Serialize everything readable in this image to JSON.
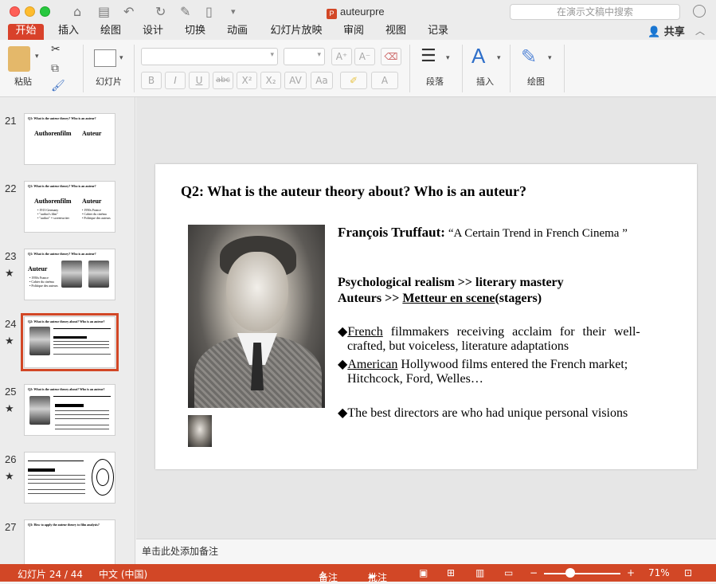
{
  "window": {
    "title": "auteurpre",
    "search_placeholder": "在演示文稿中搜索"
  },
  "tabs": [
    "开始",
    "插入",
    "绘图",
    "设计",
    "切换",
    "动画",
    "幻灯片放映",
    "审阅",
    "视图",
    "记录"
  ],
  "active_tab": "开始",
  "share_label": "共享",
  "ribbon": {
    "paste": "粘贴",
    "slide": "幻灯片",
    "paragraph": "段落",
    "insert": "插入",
    "draw": "绘图",
    "fmt": {
      "bold": "B",
      "italic": "I",
      "underline": "U",
      "strike": "abc",
      "superscript": "X²",
      "subscript": "X₂",
      "spacing": "AV",
      "case": "Aa",
      "font_color": "A"
    }
  },
  "thumbnails": [
    {
      "num": "21",
      "star": false,
      "title": "Q1: What is the auteur theory? Who is an auteur?",
      "col1": "Authorenfilm",
      "col2": "Auteur"
    },
    {
      "num": "22",
      "star": false,
      "title": "Q1: What is the auteur theory? Who is an auteur?",
      "col1": "Authorenfilm",
      "col2": "Auteur",
      "bullets1": [
        "• 1913 Germany",
        "• \"author's film\"",
        "• \"author\" = screenwriter"
      ],
      "bullets2": [
        "• 1950s France",
        "• Cahier du cinéma",
        "• Politique des auteurs"
      ]
    },
    {
      "num": "23",
      "star": true,
      "title": "Q1: What is the auteur theory? Who is an auteur?",
      "col1": "Auteur",
      "bullets1": [
        "• 1950s France",
        "• Cahier du cinéma",
        "• Politique des auteurs"
      ]
    },
    {
      "num": "24",
      "star": true,
      "title": "Q2: What is the auteur theory about? Who is an auteur?"
    },
    {
      "num": "25",
      "star": true,
      "title": "Q2: What is the auteur theory about? Who is an auteur?"
    },
    {
      "num": "26",
      "star": true,
      "title": ""
    },
    {
      "num": "27",
      "star": false,
      "title": "Q3: How to apply the auteur theory to film analysis?"
    }
  ],
  "slide": {
    "title": "Q2: What is the auteur theory about? Who is an auteur?",
    "name": "François Truffaut:",
    "quote": "“A Certain Trend in French Cinema ”",
    "line1": "Psychological realism >> literary mastery",
    "line2a": "Auteurs >> ",
    "line2b": "Metteur en scene",
    "line2c": "(stagers)",
    "b1_word": "French",
    "b1_rest": " filmmakers receiving acclaim for their well-",
    "b1_cont": "crafted, but voiceless, literature adaptations",
    "b2_word": "American",
    "b2_rest": " Hollywood films entered the French market;",
    "b2_cont": "Hitchcock, Ford, Welles…",
    "b3": "The best directors are who had unique personal visions",
    "bullet": "◆"
  },
  "notes_placeholder": "单击此处添加备注",
  "status": {
    "slide_counter": "幻灯片 24 / 44",
    "language": "中文 (中国)",
    "notes": "备注",
    "comments": "批注",
    "zoom": "71%"
  },
  "colors": {
    "accent": "#d24726",
    "tab_active": "#d8412a"
  }
}
